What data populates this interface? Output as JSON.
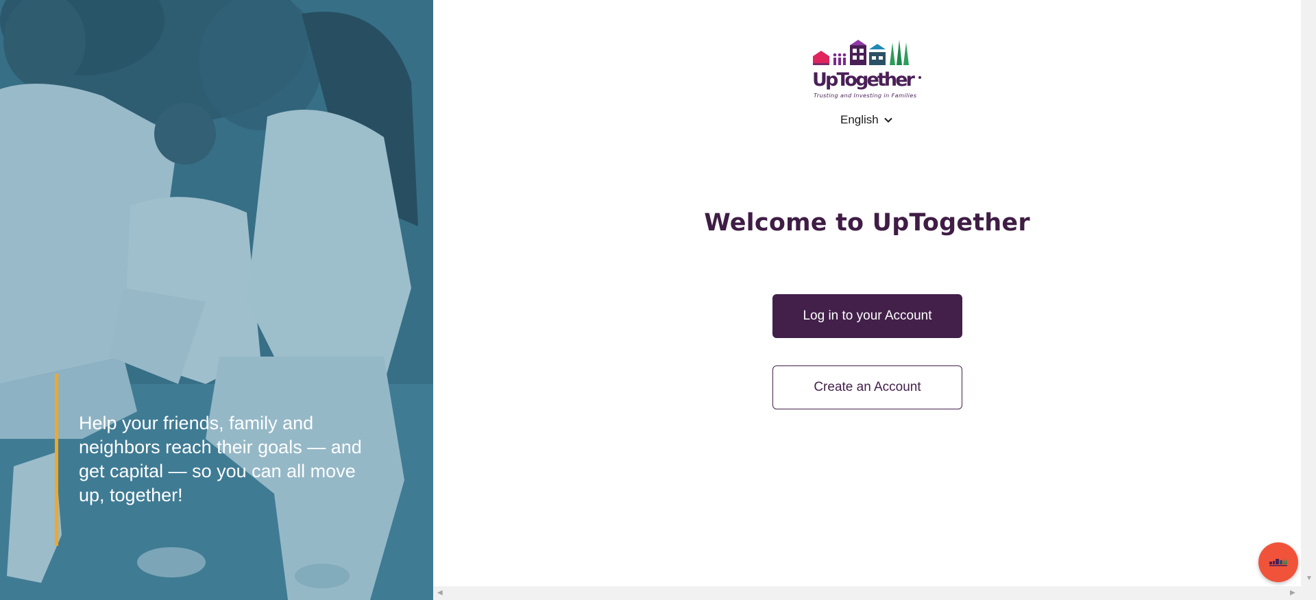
{
  "hero": {
    "quote": "Help your friends, family and neighbors reach their goals — and get capital — so you can all move up, together!",
    "overlay_color": "#3d7891",
    "accent_color": "#f5a623"
  },
  "brand": {
    "name": "UpTogether",
    "tagline": "Trusting and Investing in Families",
    "primary_color": "#42204a"
  },
  "language": {
    "selected": "English",
    "icon": "chevron-down-icon"
  },
  "main": {
    "welcome_title": "Welcome to UpTogether",
    "login_label": "Log in to your Account",
    "create_label": "Create an Account"
  },
  "chat": {
    "icon": "uptogether-chat-icon",
    "color": "#f0533a"
  }
}
